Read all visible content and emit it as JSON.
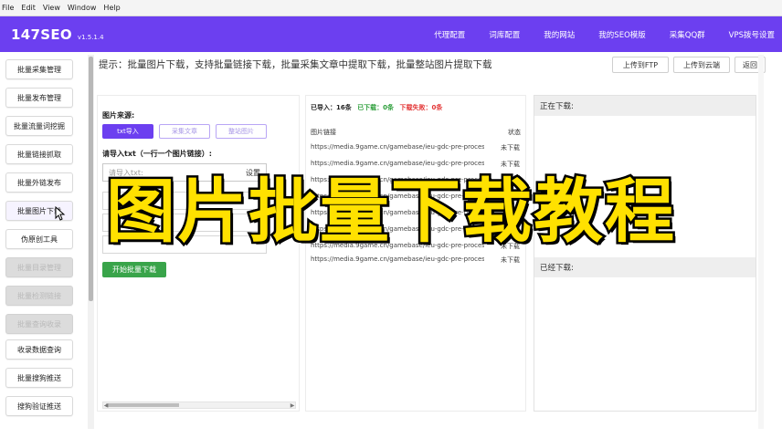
{
  "window_menu": [
    "File",
    "Edit",
    "View",
    "Window",
    "Help"
  ],
  "header": {
    "logo": "147SEO",
    "version": "v1.5.1.4",
    "nav": [
      "代理配置",
      "词库配置",
      "我的网站",
      "我的SEO模版",
      "采集QQ群",
      "VPS拨号设置"
    ]
  },
  "sidebar": {
    "items": [
      {
        "label": "批量采集管理",
        "state": "normal"
      },
      {
        "label": "批量发布管理",
        "state": "normal"
      },
      {
        "label": "批量流量词挖掘",
        "state": "normal"
      },
      {
        "label": "批量链接抓取",
        "state": "normal"
      },
      {
        "label": "批量外链发布",
        "state": "normal"
      },
      {
        "label": "批量图片下载",
        "state": "active"
      },
      {
        "label": "伪原创工具",
        "state": "normal"
      },
      {
        "label": "批量目录管理",
        "state": "disabled"
      },
      {
        "label": "批量检测链接",
        "state": "disabled"
      },
      {
        "label": "批量查询收录",
        "state": "disabled"
      },
      {
        "label": "收录数据查询",
        "state": "normal"
      },
      {
        "label": "批量搜狗推送",
        "state": "normal"
      },
      {
        "label": "搜狗验证推送",
        "state": "normal"
      }
    ]
  },
  "tip": "提示：批量图片下载，支持批量链接下载，批量采集文章中提取下载，批量整站图片提取下载",
  "top_buttons": [
    "上传到FTP",
    "上传到云端",
    "返回"
  ],
  "left_panel": {
    "source_label": "图片来源:",
    "sources": [
      "txt导入",
      "采集文章",
      "整站图片"
    ],
    "active_source": "txt导入",
    "import_label": "请导入txt（一行一个图片链接）:",
    "txt_placeholder": "请导入txt:",
    "upload_label": "设置",
    "start_button": "开始批量下载"
  },
  "mid_panel": {
    "stats": {
      "imported": "已导入：16条",
      "downloaded": "已下载：0条",
      "failed": "下载失败：0条"
    },
    "col_link": "图片链接",
    "col_status": "状态",
    "rows": [
      {
        "url": "https://media.9game.cn/gamebase/ieu-gdc-pre-process/image...",
        "status": "未下载"
      },
      {
        "url": "https://media.9game.cn/gamebase/ieu-gdc-pre-process/image...",
        "status": "未下载"
      },
      {
        "url": "https://media.9game.cn/gamebase/ieu-gdc-pre-process/image...",
        "status": "未下载"
      },
      {
        "url": "https://media.9game.cn/gamebase/ieu-gdc-pre-process/image...",
        "status": "未下载"
      },
      {
        "url": "https://media.9game.cn/gamebase/ieu-gdc-pre-process/image...",
        "status": "未下载"
      },
      {
        "url": "https://media.9game.cn/gamebase/ieu-gdc-pre-process/image...",
        "status": "未下载"
      },
      {
        "url": "https://media.9game.cn/gamebase/ieu-gdc-pre-process/image...",
        "status": "未下载"
      },
      {
        "url": "https://media.9game.cn/gamebase/ieu-gdc-pre-process/image",
        "status": "未下载"
      }
    ]
  },
  "right_panel": {
    "downloading_label": "正在下载:",
    "downloaded_label": "已经下载:"
  },
  "overlay_caption": "图片批量下载教程",
  "colors": {
    "brand": "#6c3ff0",
    "start": "#39a44a",
    "caption": "#ffe100",
    "downloaded": "#2c9e3a",
    "failed": "#e33636"
  }
}
